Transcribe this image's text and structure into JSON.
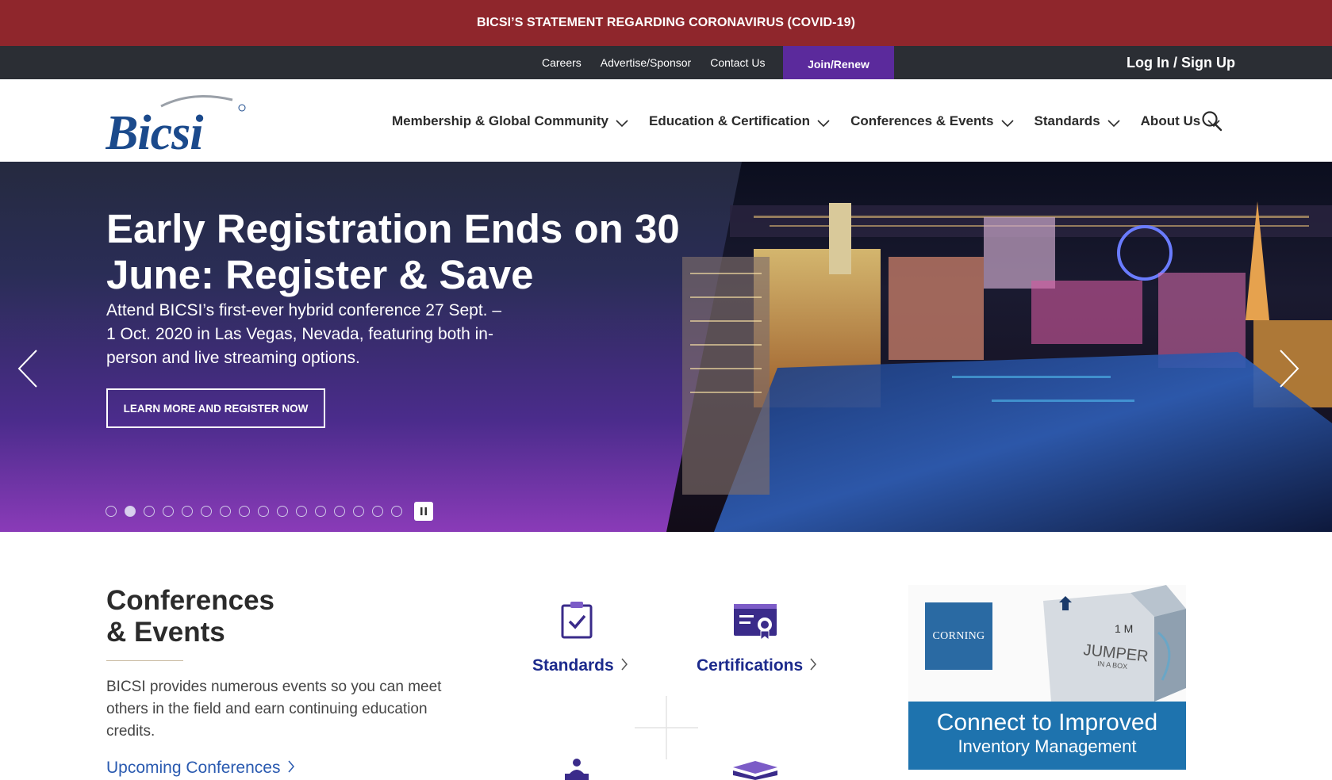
{
  "alert": {
    "text": "BICSI’S STATEMENT REGARDING CORONAVIRUS (COVID-19)"
  },
  "utility": {
    "links": [
      "Careers",
      "Advertise/Sponsor",
      "Contact Us"
    ],
    "join": "Join/Renew",
    "login": "Log In / Sign Up"
  },
  "brand": {
    "logo_text": "Bicsi",
    "logo_color": "#1b4a8c"
  },
  "nav": {
    "items": [
      "Membership & Global Community",
      "Education & Certification",
      "Conferences & Events",
      "Standards",
      "About Us"
    ],
    "search_icon": "search-icon"
  },
  "hero": {
    "title": "Early Registration Ends on 30 June: Register & Save",
    "subtitle": "Attend BICSI’s first-ever hybrid conference 27 Sept. – 1 Oct. 2020 in Las Vegas, Nevada, featuring both in-person and live streaming options.",
    "cta": "LEARN MORE AND REGISTER NOW",
    "slide_count": 16,
    "active_slide": 2,
    "prev_icon": "chevron-left-icon",
    "next_icon": "chevron-right-icon",
    "pause_icon": "pause-icon"
  },
  "conferences": {
    "title_line1": "Conferences",
    "title_line2": "& Events",
    "description": "BICSI provides numerous events so you can meet others in the field and earn continuing education credits.",
    "link": "Upcoming Conferences"
  },
  "features": [
    {
      "label": "Standards",
      "icon": "clipboard-check-icon"
    },
    {
      "label": "Certifications",
      "icon": "certificate-icon"
    }
  ],
  "ad": {
    "brand": "CORNING",
    "box_text1": "1 M",
    "box_text2": "JUMPER",
    "box_text3": "IN A BOX",
    "headline": "Connect to Improved",
    "subline": "Inventory Management"
  },
  "colors": {
    "alert": "#8f262c",
    "utility": "#2b2e34",
    "join": "#5b2a9c",
    "link_blue": "#1c2a8c",
    "ad_blue": "#1e73ae"
  }
}
